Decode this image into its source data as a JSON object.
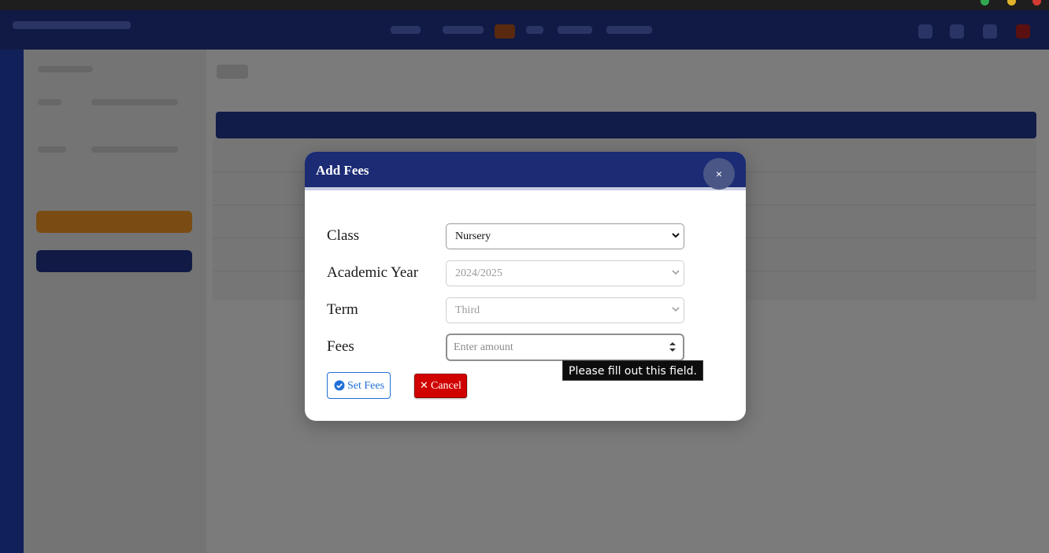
{
  "modal": {
    "title": "Add Fees",
    "close_label": "×",
    "fields": {
      "class": {
        "label": "Class",
        "value": "Nursery"
      },
      "academic_year": {
        "label": "Academic Year",
        "value": "2024/2025"
      },
      "term": {
        "label": "Term",
        "value": "Third"
      },
      "fees": {
        "label": "Fees",
        "value": "",
        "placeholder": "Enter amount"
      }
    },
    "buttons": {
      "set_fees": "Set Fees",
      "cancel": "Cancel",
      "cancel_icon": "✕"
    },
    "validation_tooltip": "Please fill out this field."
  },
  "colors": {
    "modal_header": "#1b2b74",
    "primary_outline": "#1f6fd8",
    "danger": "#d10000",
    "backdrop": "#6f6f6f"
  },
  "icons": {
    "close": "close-icon",
    "set_fees": "check-circle-icon",
    "cancel": "x-icon",
    "select_chevron": "chevron-down-icon",
    "number_spinner": "spinner-arrows-icon"
  }
}
